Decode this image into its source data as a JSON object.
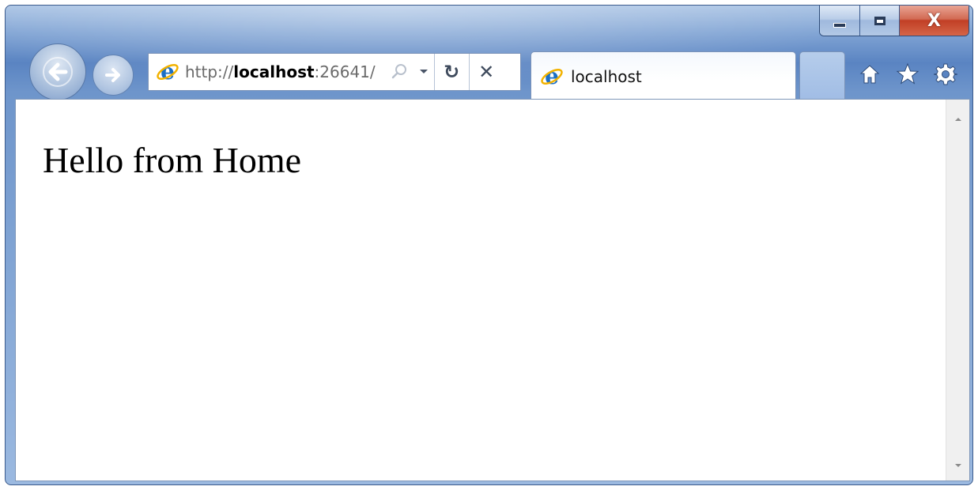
{
  "window": {
    "caption_buttons": {
      "minimize_icon": "minimize-icon",
      "maximize_icon": "maximize-icon",
      "close_label": "X"
    }
  },
  "navigation": {
    "back_icon": "back-arrow-icon",
    "forward_icon": "forward-arrow-icon"
  },
  "address_bar": {
    "url_prefix": "http://",
    "url_host": "localhost",
    "url_suffix": ":26641/",
    "icons": [
      "ie-logo-icon",
      "search-icon",
      "dropdown-arrow-icon",
      "refresh-icon",
      "stop-icon"
    ],
    "refresh_glyph": "↻",
    "stop_glyph": "✕"
  },
  "tabs": [
    {
      "title": "localhost",
      "active": true,
      "icon": "ie-logo-icon"
    }
  ],
  "toolbar": {
    "icons": [
      "home-icon",
      "favorites-star-icon",
      "settings-gear-icon"
    ]
  },
  "page": {
    "heading": "Hello from Home"
  },
  "colors": {
    "frame_blue": "#5a84c2",
    "close_red": "#c13f25",
    "ie_blue": "#1b6fc5",
    "ie_gold": "#f2b200"
  }
}
